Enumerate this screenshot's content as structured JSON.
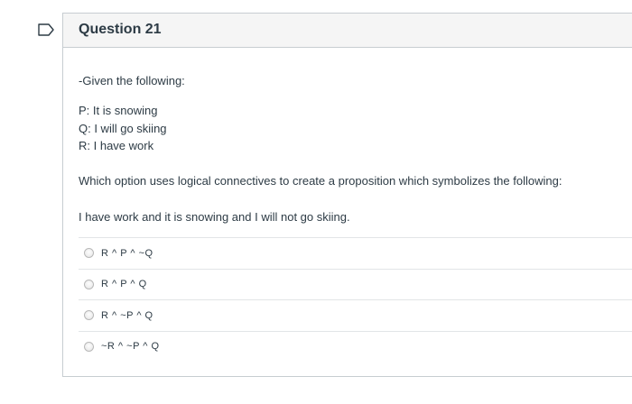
{
  "question": {
    "title": "Question 21",
    "intro": "-Given the following:",
    "premises": [
      "P: It is snowing",
      "Q: I will go skiing",
      "R: I have work"
    ],
    "prompt": "Which option uses logical connectives to create a proposition which symbolizes the following:",
    "statement": "I have work and it is snowing and I will not go skiing.",
    "answers": [
      {
        "label": "R ^ P ^ ~Q"
      },
      {
        "label": "R ^ P ^ Q"
      },
      {
        "label": "R ^ ~P ^ Q"
      },
      {
        "label": "~R ^ ~P ^ Q"
      }
    ]
  },
  "colors": {
    "border": "#c7cdd1",
    "header_bg": "#f5f5f5",
    "text": "#2d3b45"
  },
  "icons": {
    "flag": "flag-question-icon",
    "radio": "radio-unchecked-icon"
  }
}
